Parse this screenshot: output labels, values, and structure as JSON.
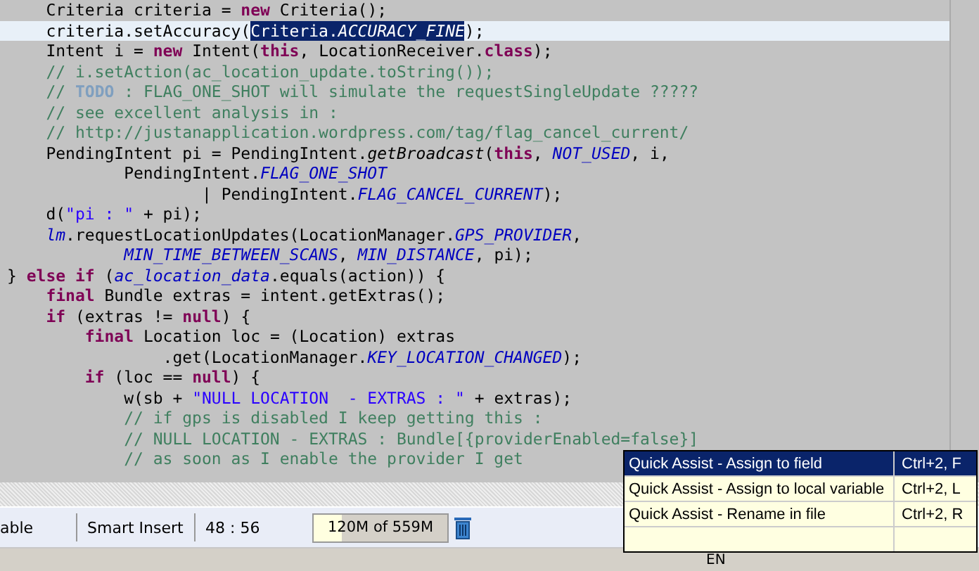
{
  "editor": {
    "lines": [
      {
        "current": false,
        "tokens": [
          {
            "kind": "plain",
            "text": "    Criteria criteria = "
          },
          {
            "kind": "keyword",
            "text": "new"
          },
          {
            "kind": "plain",
            "text": " Criteria();"
          }
        ]
      },
      {
        "current": true,
        "tokens": [
          {
            "kind": "plain",
            "text": "    criteria.setAccuracy("
          },
          {
            "kind": "selected",
            "text": "Criteria."
          },
          {
            "kind": "selected-constant",
            "text": "ACCURACY_FINE"
          },
          {
            "kind": "plain",
            "text": ");"
          }
        ]
      },
      {
        "current": false,
        "tokens": [
          {
            "kind": "plain",
            "text": "    Intent i = "
          },
          {
            "kind": "keyword",
            "text": "new"
          },
          {
            "kind": "plain",
            "text": " Intent("
          },
          {
            "kind": "keyword",
            "text": "this"
          },
          {
            "kind": "plain",
            "text": ", LocationReceiver."
          },
          {
            "kind": "keyword",
            "text": "class"
          },
          {
            "kind": "plain",
            "text": ");"
          }
        ]
      },
      {
        "current": false,
        "tokens": [
          {
            "kind": "comment",
            "text": "    // i.setAction(ac_location_update.toString());"
          }
        ]
      },
      {
        "current": false,
        "tokens": [
          {
            "kind": "comment",
            "text": "    // "
          },
          {
            "kind": "todo",
            "text": "TODO"
          },
          {
            "kind": "comment",
            "text": " : FLAG_ONE_SHOT will simulate the requestSingleUpdate ?????"
          }
        ]
      },
      {
        "current": false,
        "tokens": [
          {
            "kind": "comment",
            "text": "    // see excellent analysis in :"
          }
        ]
      },
      {
        "current": false,
        "tokens": [
          {
            "kind": "comment",
            "text": "    // http://justanapplication.wordpress.com/tag/flag_cancel_current/"
          }
        ]
      },
      {
        "current": false,
        "tokens": [
          {
            "kind": "plain",
            "text": "    PendingIntent pi = PendingIntent."
          },
          {
            "kind": "method",
            "text": "getBroadcast"
          },
          {
            "kind": "plain",
            "text": "("
          },
          {
            "kind": "keyword",
            "text": "this"
          },
          {
            "kind": "plain",
            "text": ", "
          },
          {
            "kind": "constant",
            "text": "NOT_USED"
          },
          {
            "kind": "plain",
            "text": ", i,"
          }
        ]
      },
      {
        "current": false,
        "tokens": [
          {
            "kind": "plain",
            "text": "            PendingIntent."
          },
          {
            "kind": "constant",
            "text": "FLAG_ONE_SHOT"
          }
        ]
      },
      {
        "current": false,
        "tokens": [
          {
            "kind": "plain",
            "text": "                    | PendingIntent."
          },
          {
            "kind": "constant",
            "text": "FLAG_CANCEL_CURRENT"
          },
          {
            "kind": "plain",
            "text": ");"
          }
        ]
      },
      {
        "current": false,
        "tokens": [
          {
            "kind": "plain",
            "text": "    d("
          },
          {
            "kind": "string",
            "text": "\"pi : \""
          },
          {
            "kind": "plain",
            "text": " + pi);"
          }
        ]
      },
      {
        "current": false,
        "tokens": [
          {
            "kind": "field",
            "text": "    lm"
          },
          {
            "kind": "plain",
            "text": ".requestLocationUpdates(LocationManager."
          },
          {
            "kind": "constant",
            "text": "GPS_PROVIDER"
          },
          {
            "kind": "plain",
            "text": ","
          }
        ]
      },
      {
        "current": false,
        "tokens": [
          {
            "kind": "constant",
            "text": "            MIN_TIME_BETWEEN_SCANS"
          },
          {
            "kind": "plain",
            "text": ", "
          },
          {
            "kind": "constant",
            "text": "MIN_DISTANCE"
          },
          {
            "kind": "plain",
            "text": ", pi);"
          }
        ]
      },
      {
        "current": false,
        "tokens": [
          {
            "kind": "plain",
            "text": "} "
          },
          {
            "kind": "keyword",
            "text": "else if"
          },
          {
            "kind": "plain",
            "text": " ("
          },
          {
            "kind": "constant",
            "text": "ac_location_data"
          },
          {
            "kind": "plain",
            "text": ".equals(action)) {"
          }
        ]
      },
      {
        "current": false,
        "tokens": [
          {
            "kind": "keyword",
            "text": "    final"
          },
          {
            "kind": "plain",
            "text": " Bundle extras = intent.getExtras();"
          }
        ]
      },
      {
        "current": false,
        "tokens": [
          {
            "kind": "keyword",
            "text": "    if"
          },
          {
            "kind": "plain",
            "text": " (extras != "
          },
          {
            "kind": "keyword",
            "text": "null"
          },
          {
            "kind": "plain",
            "text": ") {"
          }
        ]
      },
      {
        "current": false,
        "tokens": [
          {
            "kind": "keyword",
            "text": "        final"
          },
          {
            "kind": "plain",
            "text": " Location loc = (Location) extras"
          }
        ]
      },
      {
        "current": false,
        "tokens": [
          {
            "kind": "plain",
            "text": "                .get(LocationManager."
          },
          {
            "kind": "constant",
            "text": "KEY_LOCATION_CHANGED"
          },
          {
            "kind": "plain",
            "text": ");"
          }
        ]
      },
      {
        "current": false,
        "tokens": [
          {
            "kind": "keyword",
            "text": "        if"
          },
          {
            "kind": "plain",
            "text": " (loc == "
          },
          {
            "kind": "keyword",
            "text": "null"
          },
          {
            "kind": "plain",
            "text": ") {"
          }
        ]
      },
      {
        "current": false,
        "tokens": [
          {
            "kind": "plain",
            "text": "            w(sb + "
          },
          {
            "kind": "string",
            "text": "\"NULL LOCATION  - EXTRAS : \""
          },
          {
            "kind": "plain",
            "text": " + extras);"
          }
        ]
      },
      {
        "current": false,
        "tokens": [
          {
            "kind": "comment",
            "text": "            // if gps is disabled I keep getting this :"
          }
        ]
      },
      {
        "current": false,
        "tokens": [
          {
            "kind": "comment",
            "text": "            // NULL LOCATION - EXTRAS : Bundle[{providerEnabled=false}]"
          }
        ]
      },
      {
        "current": false,
        "tokens": [
          {
            "kind": "comment",
            "text": "            // as soon as I enable the provider I get"
          }
        ]
      }
    ]
  },
  "status_bar": {
    "mode": "able",
    "insert_mode": "Smart Insert",
    "position": "48 : 56",
    "memory": {
      "text": "120M of 559M",
      "level": 0.215
    }
  },
  "quick_assist": {
    "items": [
      {
        "label": "Quick Assist - Assign to field",
        "shortcut": "Ctrl+2, F",
        "selected": true
      },
      {
        "label": "Quick Assist - Assign to local variable",
        "shortcut": "Ctrl+2, L",
        "selected": false
      },
      {
        "label": "Quick Assist - Rename in file",
        "shortcut": "Ctrl+2, R",
        "selected": false
      }
    ]
  },
  "taskbar": {
    "language": "EN"
  }
}
